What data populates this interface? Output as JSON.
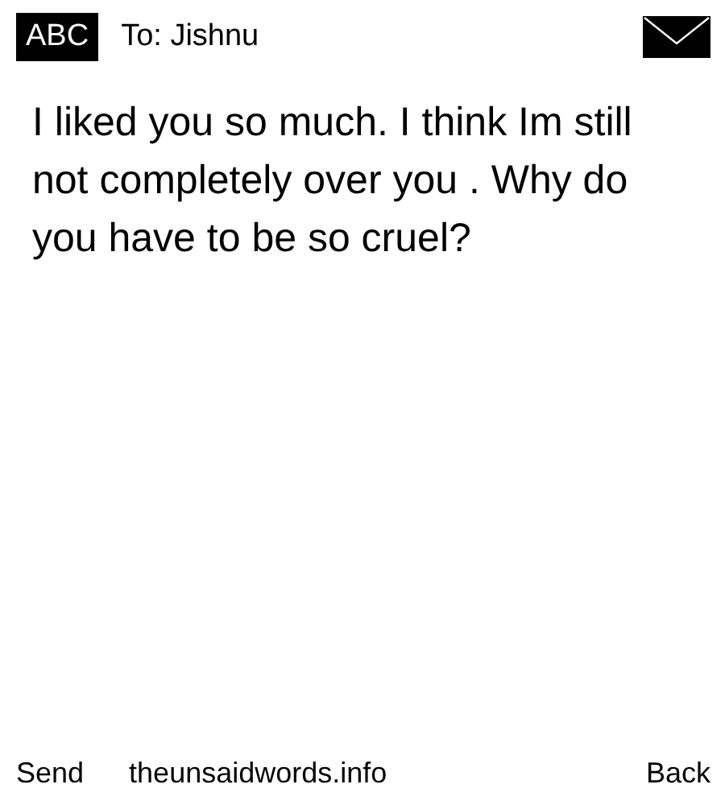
{
  "header": {
    "input_mode": "ABC",
    "recipient": "To: Jishnu"
  },
  "message": "I liked you so much. I think Im still not completely over you . Why do you have to be so cruel?",
  "footer": {
    "left": "Send",
    "center": "theunsaidwords.info",
    "right": "Back"
  }
}
